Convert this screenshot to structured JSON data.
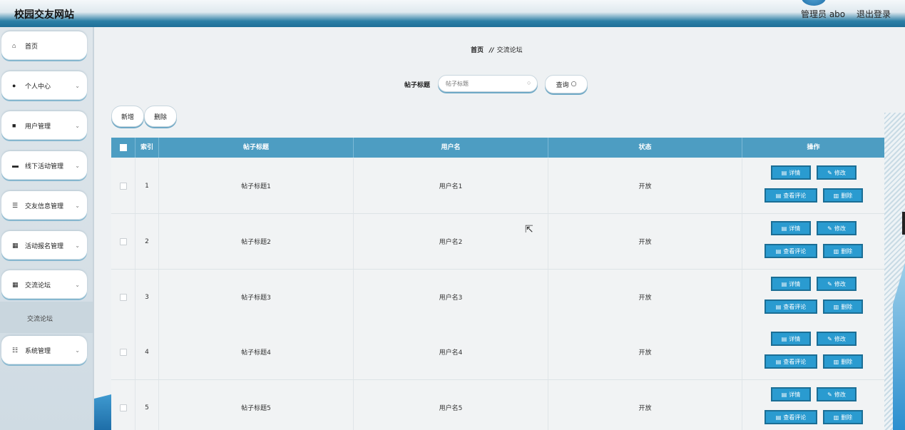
{
  "header": {
    "app_title": "校园交友网站",
    "admin_label": "管理员 abo",
    "logout_label": "退出登录"
  },
  "sidebar": {
    "items": [
      {
        "label": "首页",
        "icon": "home-icon",
        "glyph": "⌂",
        "has_arrow": false
      },
      {
        "label": "个人中心",
        "icon": "user-icon",
        "glyph": "●",
        "has_arrow": true
      },
      {
        "label": "用户管理",
        "icon": "clipboard-icon",
        "glyph": "■",
        "has_arrow": true
      },
      {
        "label": "线下活动管理",
        "icon": "briefcase-icon",
        "glyph": "▬",
        "has_arrow": true
      },
      {
        "label": "交友信息管理",
        "icon": "list-icon",
        "glyph": "☰",
        "has_arrow": true
      },
      {
        "label": "活动报名管理",
        "icon": "grid-icon",
        "glyph": "▦",
        "has_arrow": true
      },
      {
        "label": "交流论坛",
        "icon": "grid-icon",
        "glyph": "▦",
        "has_arrow": true
      },
      {
        "label": "系统管理",
        "icon": "sliders-icon",
        "glyph": "☷",
        "has_arrow": true
      }
    ],
    "submenu_label": "交流论坛"
  },
  "breadcrumb": {
    "home": "首页",
    "separator": "//",
    "current": "交流论坛"
  },
  "search": {
    "label": "帖子标题",
    "placeholder": "帖子标题",
    "query_label": "查询"
  },
  "toolbar": {
    "add_label": "新增",
    "delete_label": "删除"
  },
  "table": {
    "columns": [
      "索引",
      "帖子标题",
      "用户名",
      "状态",
      "操作"
    ],
    "rows": [
      {
        "index": "1",
        "title": "帖子标题1",
        "username": "用户名1",
        "status": "开放"
      },
      {
        "index": "2",
        "title": "帖子标题2",
        "username": "用户名2",
        "status": "开放"
      },
      {
        "index": "3",
        "title": "帖子标题3",
        "username": "用户名3",
        "status": "开放"
      },
      {
        "index": "4",
        "title": "帖子标题4",
        "username": "用户名4",
        "status": "开放"
      },
      {
        "index": "5",
        "title": "帖子标题5",
        "username": "用户名5",
        "status": "开放"
      }
    ],
    "actions": {
      "detail": "详情",
      "edit": "修改",
      "view_comments": "查看评论",
      "delete": "删除"
    }
  },
  "colors": {
    "accent": "#2a9bd0",
    "table_header": "#4d9dc2",
    "header_bar": "#1f6f98"
  }
}
